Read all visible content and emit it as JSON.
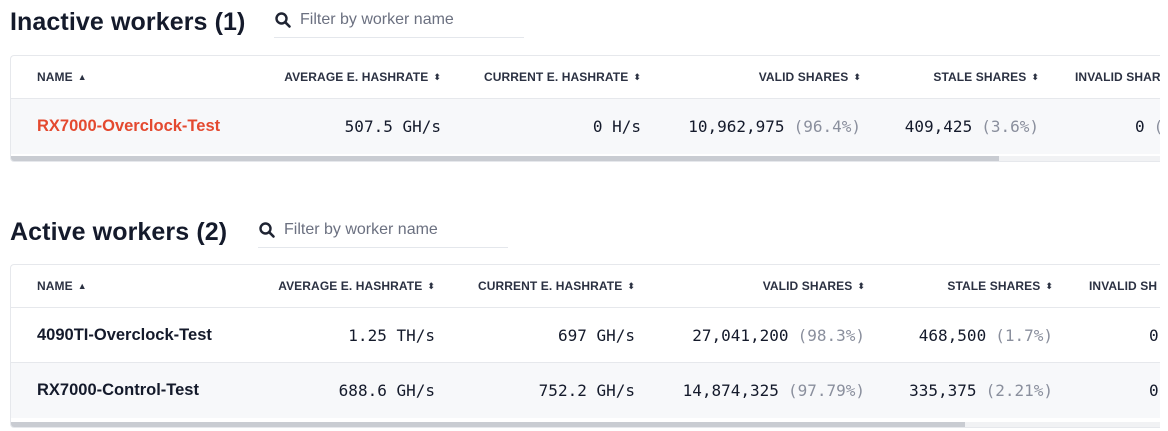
{
  "inactive": {
    "title": "Inactive workers (1)",
    "filter_placeholder": "Filter by worker name",
    "columns": {
      "name": "NAME",
      "avg": "AVERAGE E. HASHRATE",
      "cur": "CURRENT E. HASHRATE",
      "valid": "VALID SHARES",
      "stale": "STALE SHARES",
      "invalid": "INVALID SHAR"
    },
    "rows": [
      {
        "name": "RX7000-Overclock-Test",
        "avg": "507.5 GH/s",
        "cur": "0 H/s",
        "valid": "10,962,975",
        "valid_pct": "(96.4%)",
        "stale": "409,425",
        "stale_pct": "(3.6%)",
        "invalid": "0",
        "invalid_pct": "("
      }
    ],
    "scroll_fraction": 0.86
  },
  "active": {
    "title": "Active workers (2)",
    "filter_placeholder": "Filter by worker name",
    "columns": {
      "name": "NAME",
      "avg": "AVERAGE E. HASHRATE",
      "cur": "CURRENT E. HASHRATE",
      "valid": "VALID SHARES",
      "stale": "STALE SHARES",
      "invalid": "INVALID SH"
    },
    "rows": [
      {
        "name": "4090TI-Overclock-Test",
        "avg": "1.25 TH/s",
        "cur": "697 GH/s",
        "valid": "27,041,200",
        "valid_pct": "(98.3%)",
        "stale": "468,500",
        "stale_pct": "(1.7%)",
        "invalid": "0"
      },
      {
        "name": "RX7000-Control-Test",
        "avg": "688.6 GH/s",
        "cur": "752.2 GH/s",
        "valid": "14,874,325",
        "valid_pct": "(97.79%)",
        "stale": "335,375",
        "stale_pct": "(2.21%)",
        "invalid": "0"
      }
    ],
    "scroll_fraction": 0.83
  },
  "icons": {
    "search": "search-icon",
    "sort_asc": "sort-asc-icon",
    "sort_both": "sort-both-icon"
  },
  "colors": {
    "inactive_name": "#e4492f",
    "text": "#141a2b",
    "muted": "#8a8f9d",
    "border": "#e6e8ec"
  }
}
